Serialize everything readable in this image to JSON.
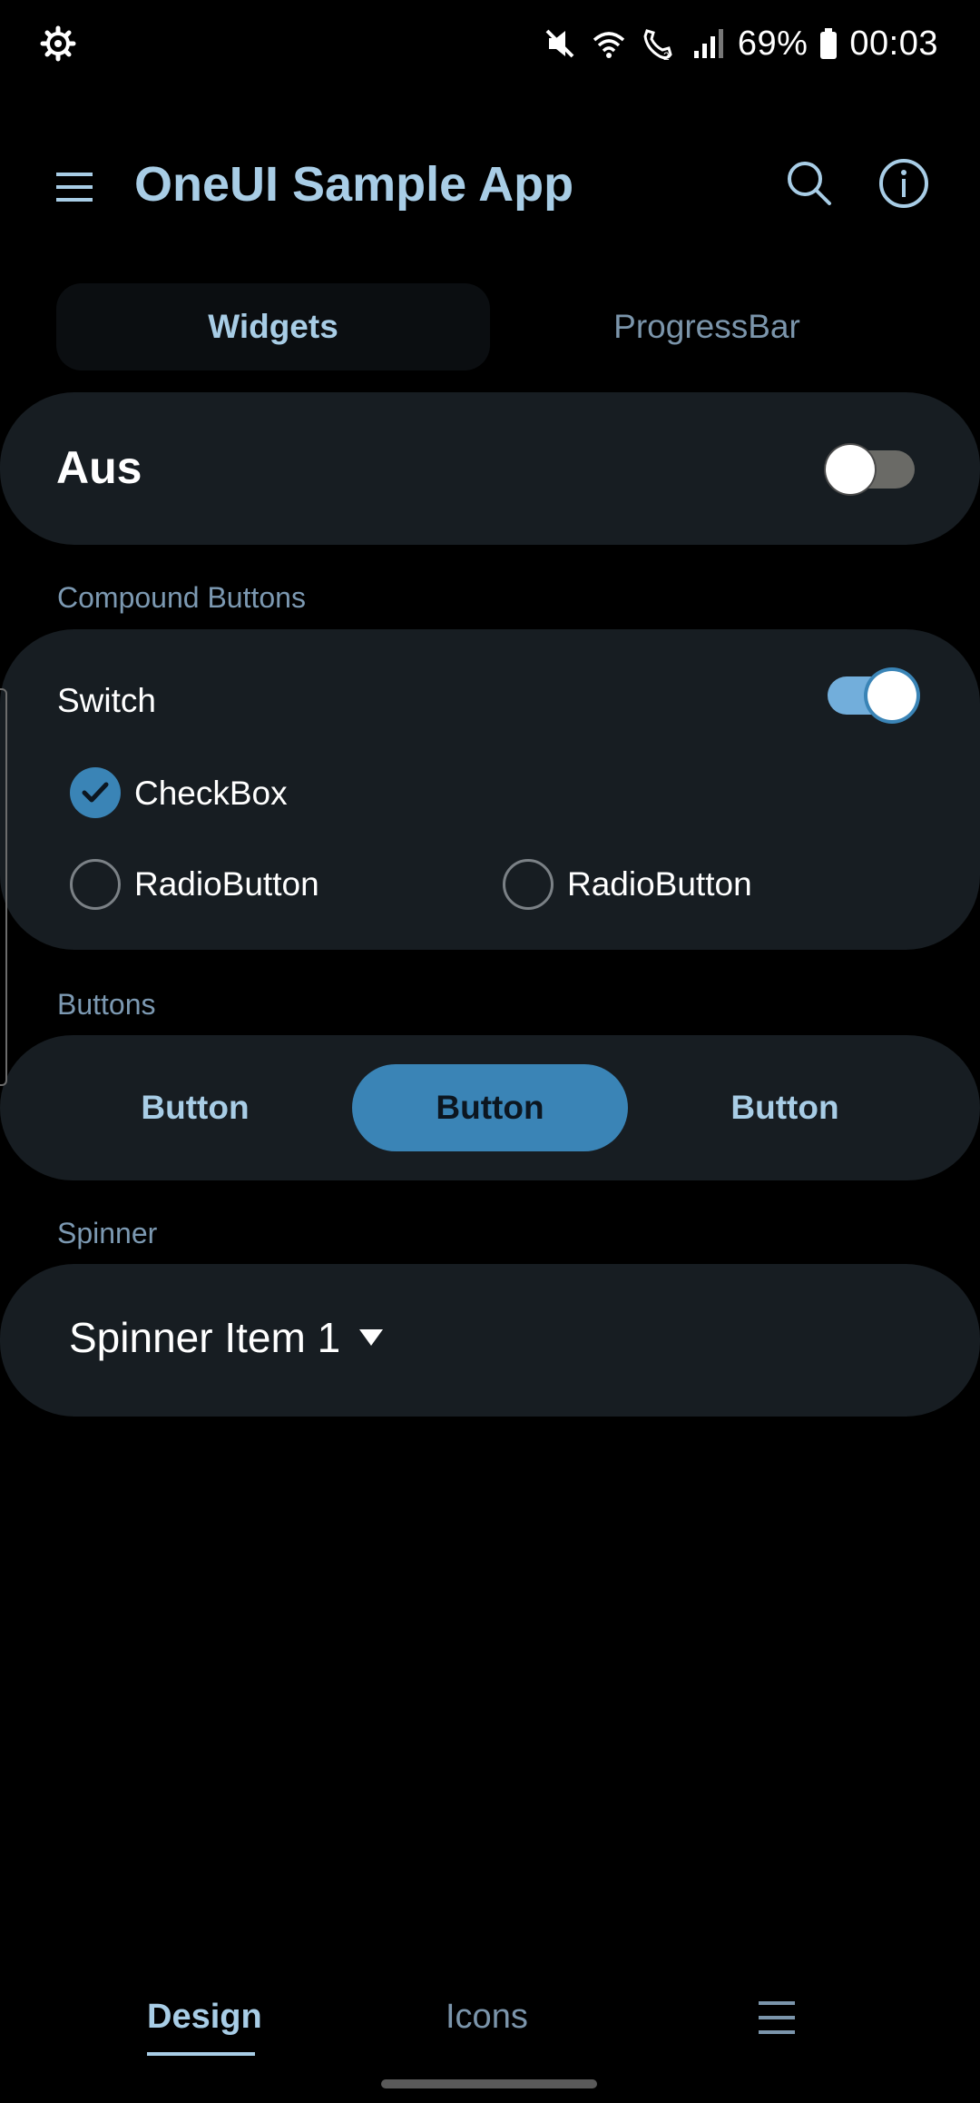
{
  "status_bar": {
    "battery": "69%",
    "time": "00:03",
    "icons": [
      "settings-gear-icon",
      "mute-icon",
      "wifi-icon",
      "wifi-calling-icon",
      "signal-icon",
      "battery-icon"
    ]
  },
  "app_bar": {
    "title": "OneUI Sample App",
    "icons": [
      "menu-icon",
      "search-icon",
      "info-icon"
    ]
  },
  "tabs": [
    {
      "label": "Widgets",
      "selected": true
    },
    {
      "label": "ProgressBar",
      "selected": false
    }
  ],
  "master_switch": {
    "label": "Aus",
    "checked": false
  },
  "compound": {
    "section_title": "Compound Buttons",
    "switch_label": "Switch",
    "switch_checked": true,
    "checkbox_label": "CheckBox",
    "checkbox_checked": true,
    "radio1_label": "RadioButton",
    "radio2_label": "RadioButton"
  },
  "buttons": {
    "section_title": "Buttons",
    "labels": [
      "Button",
      "Button",
      "Button"
    ]
  },
  "spinner": {
    "section_title": "Spinner",
    "selected": "Spinner Item 1"
  },
  "bottom_nav": {
    "design": "Design",
    "icons": "Icons",
    "selected": "Design"
  },
  "colors": {
    "accent": "#a8cde6",
    "primary": "#3a84b6",
    "card": "#171d22",
    "background": "#000000"
  }
}
